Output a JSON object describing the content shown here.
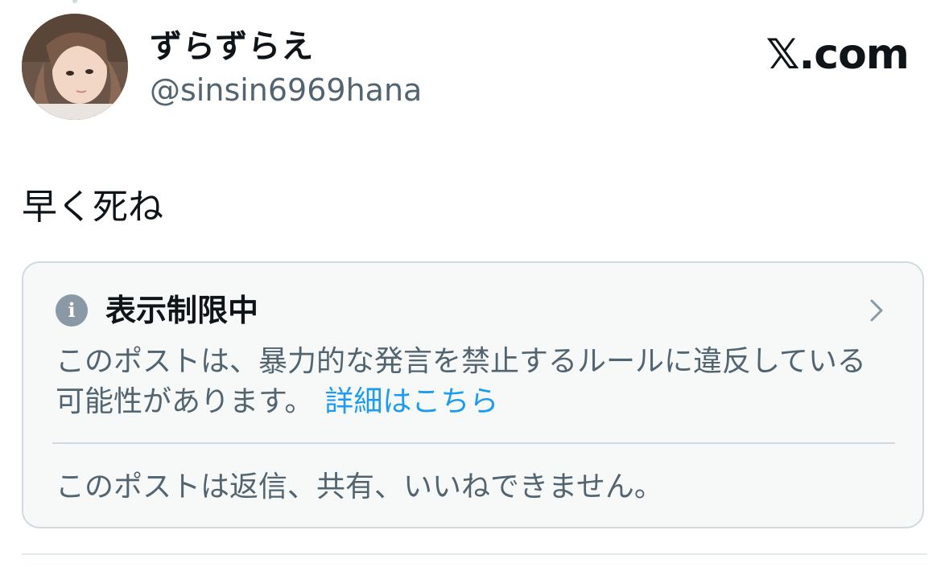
{
  "author": {
    "display_name": "ずらずらえ",
    "handle": "@sinsin6969hana"
  },
  "brand": {
    "label": "𝕏.com"
  },
  "post": {
    "text": "早く死ね"
  },
  "notice": {
    "icon": "info-icon",
    "icon_glyph": "i",
    "title": "表示制限中",
    "body": "このポストは、暴力的な発言を禁止するルールに違反している可能性があります。",
    "link_label": "詳細はこちら",
    "footer": "このポストは返信、共有、いいねできません。"
  },
  "colors": {
    "text_primary": "#0f1419",
    "text_secondary": "#536471",
    "link": "#1d9bf0",
    "border": "#cfd9de",
    "notice_bg": "#f7f9f9"
  }
}
